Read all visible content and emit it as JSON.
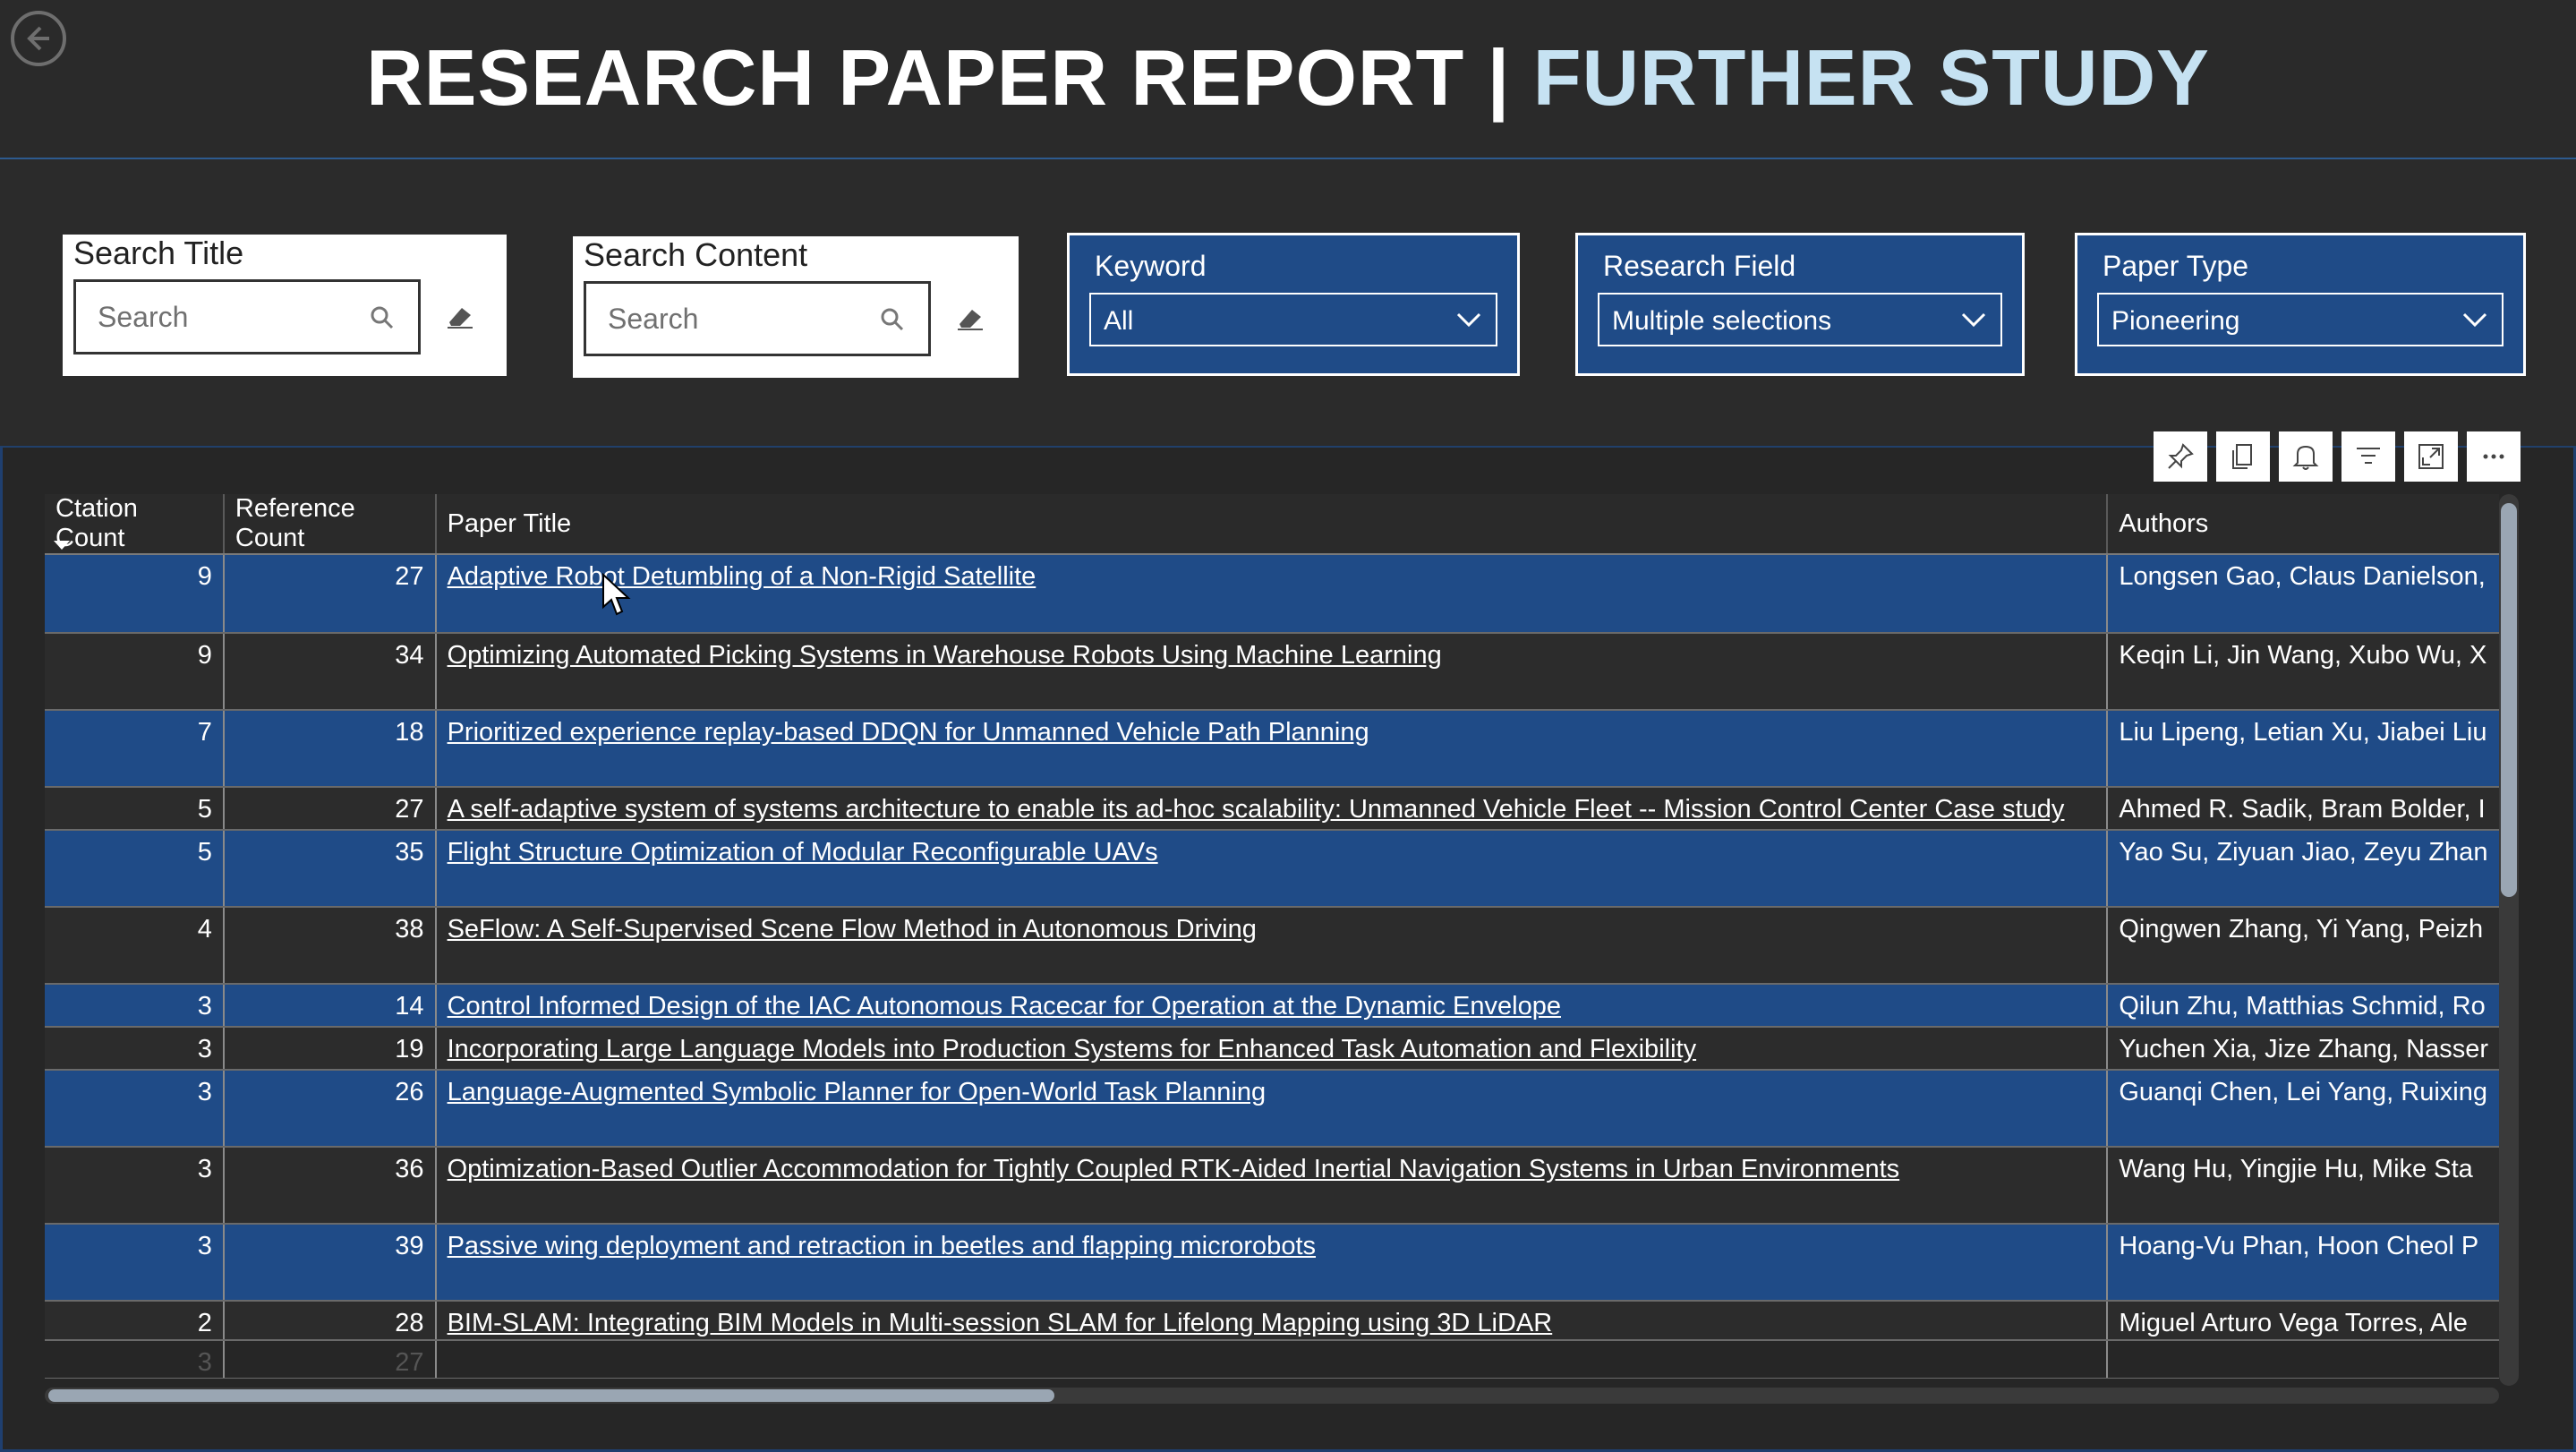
{
  "header": {
    "title_main": "RESEARCH PAPER REPORT | ",
    "title_accent": "FURTHER STUDY"
  },
  "filters": {
    "search_title": {
      "label": "Search Title",
      "placeholder": "Search"
    },
    "search_content": {
      "label": "Search Content",
      "placeholder": "Search"
    },
    "keyword": {
      "label": "Keyword",
      "value": "All"
    },
    "research_field": {
      "label": "Research Field",
      "value": "Multiple selections"
    },
    "paper_type": {
      "label": "Paper Type",
      "value": "Pioneering"
    }
  },
  "toolbar": [
    "pin-icon",
    "copy-icon",
    "bell-icon",
    "filter-icon",
    "focus-mode-icon",
    "more-options-icon"
  ],
  "table": {
    "columns": [
      "Ctation Count",
      "Reference Count",
      "Paper Title",
      "Authors"
    ],
    "rows": [
      {
        "citation": "9",
        "reference": "27",
        "title": "Adaptive Robot Detumbling of a Non-Rigid Satellite",
        "authors": "Longsen Gao, Claus Danielson,",
        "style": "blue"
      },
      {
        "citation": "9",
        "reference": "34",
        "title": "Optimizing Automated Picking Systems in Warehouse Robots Using Machine Learning",
        "authors": "Keqin Li, Jin Wang, Xubo Wu, X",
        "style": "dark"
      },
      {
        "citation": "7",
        "reference": "18",
        "title": "Prioritized experience replay-based DDQN for Unmanned Vehicle Path Planning",
        "authors": "Liu Lipeng, Letian Xu, Jiabei Liu",
        "style": "blue"
      },
      {
        "citation": "5",
        "reference": "27",
        "title": "A self-adaptive system of systems architecture to enable its ad-hoc scalability: Unmanned Vehicle Fleet -- Mission Control Center Case study",
        "authors": "Ahmed R. Sadik, Bram Bolder, I",
        "style": "dark"
      },
      {
        "citation": "5",
        "reference": "35",
        "title": "Flight Structure Optimization of Modular Reconfigurable UAVs",
        "authors": "Yao Su, Ziyuan Jiao, Zeyu Zhan",
        "style": "blue"
      },
      {
        "citation": "4",
        "reference": "38",
        "title": "SeFlow: A Self-Supervised Scene Flow Method in Autonomous Driving",
        "authors": "Qingwen Zhang, Yi Yang, Peizh",
        "style": "dark"
      },
      {
        "citation": "3",
        "reference": "14",
        "title": "Control Informed Design of the IAC Autonomous Racecar for Operation at the Dynamic Envelope",
        "authors": "Qilun Zhu, Matthias Schmid, Ro",
        "style": "blue"
      },
      {
        "citation": "3",
        "reference": "19",
        "title": "Incorporating Large Language Models into Production Systems for Enhanced Task Automation and Flexibility",
        "authors": "Yuchen Xia, Jize Zhang, Nasser",
        "style": "dark"
      },
      {
        "citation": "3",
        "reference": "26",
        "title": "Language-Augmented Symbolic Planner for Open-World Task Planning",
        "authors": "Guanqi Chen, Lei Yang, Ruixing",
        "style": "blue"
      },
      {
        "citation": "3",
        "reference": "36",
        "title": "Optimization-Based Outlier Accommodation for Tightly Coupled RTK-Aided Inertial Navigation Systems in Urban Environments",
        "authors": "Wang Hu, Yingjie Hu, Mike Sta",
        "style": "dark"
      },
      {
        "citation": "3",
        "reference": "39",
        "title": "Passive wing deployment and retraction in beetles and flapping microrobots",
        "authors": "Hoang-Vu Phan, Hoon Cheol P",
        "style": "blue"
      },
      {
        "citation": "2",
        "reference": "28",
        "title": "BIM-SLAM: Integrating BIM Models in Multi-session SLAM for Lifelong Mapping using 3D LiDAR",
        "authors": "Miguel Arturo Vega Torres, Ale",
        "style": "dark"
      },
      {
        "citation": "3",
        "reference": "27",
        "title": "",
        "authors": "",
        "style": "ghost"
      }
    ]
  }
}
